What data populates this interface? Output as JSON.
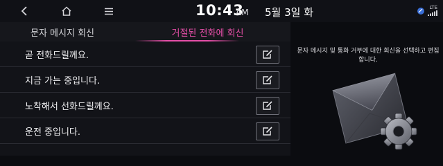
{
  "status_bar": {
    "time": "10:43",
    "ampm": "AM",
    "date": "5월 3일 화",
    "network": "LTE"
  },
  "tabs": [
    {
      "label": "문자 메시지 회신",
      "active": false
    },
    {
      "label": "거절된 전화에 회신",
      "active": true
    }
  ],
  "messages": [
    {
      "text": "곧 전화드릴께요."
    },
    {
      "text": "지금 가는 중입니다."
    },
    {
      "text": "노착해서 선화드릴께요."
    },
    {
      "text": "운전 중입니다."
    }
  ],
  "panel": {
    "description": "문자 메시지 및 통화 거부에 대한 회신을 선택하고 편집합니다."
  },
  "colors": {
    "accent": "#e64fa8",
    "background": "#0b0c10"
  }
}
